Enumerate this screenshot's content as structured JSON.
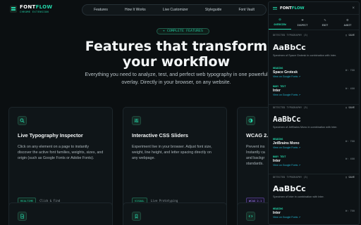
{
  "brand": {
    "name_a": "FONT",
    "name_b": "FLOW",
    "subtitle": "CHROME EXTENSION"
  },
  "nav": {
    "items": [
      "Features",
      "How It Works",
      "Live Customizer",
      "Styleguide",
      "Font Vault"
    ]
  },
  "hero": {
    "badge": "+ COMPLETE FEATURES",
    "title": "Features that transform your workflow",
    "subtitle": "Everything you need to analyze, test, and perfect web typography in one powerful overlay. Directly in your browser, on any website."
  },
  "cards": [
    {
      "title": "Live Typography Inspector",
      "desc": "Click on any element on a page to instantly discover the active font families, weights, sizes, and origin (such as Google Fonts or Adobe Fonts).",
      "tag": "REALTIME",
      "tag_text": "Click & Find"
    },
    {
      "title": "Interactive CSS Sliders",
      "desc": "Experiment live in your browser. Adjust font size, weight, line height, and letter spacing directly on any webpage.",
      "tag": "VISUAL",
      "tag_text": "Live Prototyping"
    },
    {
      "title": "WCAG 2.",
      "desc": "Prevent ins Instantly ca and backgr standards.",
      "tag": "WCAG 2.1",
      "tag_text": ""
    }
  ],
  "panel": {
    "name_a": "FONT",
    "name_b": "FLOW",
    "close": "×",
    "tabs": [
      {
        "label": "OVERVIEW",
        "icon": "◎"
      },
      {
        "label": "INSPECT",
        "icon": "⌖"
      },
      {
        "label": "EDIT",
        "icon": "✎"
      },
      {
        "label": "AUDIT",
        "icon": "⚙"
      }
    ],
    "section_label": "DETECTED TYPOGRAPHY (3)",
    "save_label": "SAVE",
    "specimens": [
      {
        "sample": "AaBbCc",
        "caption": "Specimen of Space Grotesk in combination with Inter.",
        "rows": [
          {
            "label": "HEADING",
            "font": "Space Grotesk",
            "link": "View on Google Fonts ↗",
            "meta": "W: 700"
          },
          {
            "label": "BODY TEXT",
            "font": "Inter",
            "link": "View on Google Fonts ↗",
            "meta": "W: 400"
          }
        ]
      },
      {
        "sample": "AaBbCc",
        "caption": "Specimen of JetBrains Mono in combination with Inter.",
        "rows": [
          {
            "label": "HEADING",
            "font": "JetBrains Mono",
            "link": "View on Google Fonts ↗",
            "meta": "W: 700"
          },
          {
            "label": "BODY TEXT",
            "font": "Inter",
            "link": "View on Google Fonts ↗",
            "meta": "W: 400"
          }
        ]
      },
      {
        "sample": "AaBbCc",
        "caption": "Specimen of Inter in combination with Inter.",
        "rows": [
          {
            "label": "HEADING",
            "font": "Inter",
            "link": "View on Google Fonts ↗",
            "meta": "W: 700"
          }
        ]
      }
    ]
  },
  "colors": {
    "accent": "#23d5a8",
    "background": "#0b0f11",
    "purple": "#a98bff"
  }
}
